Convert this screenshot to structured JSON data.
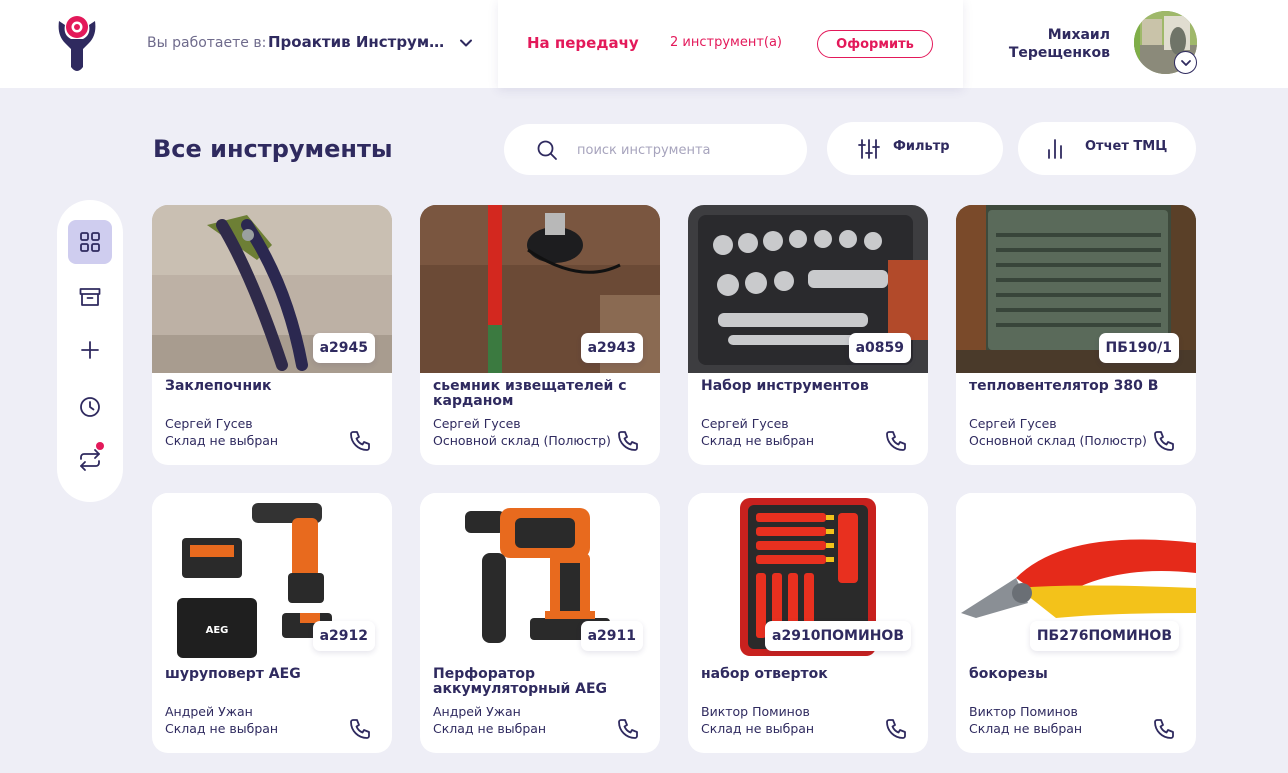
{
  "header": {
    "workspace_label": "Вы работаете в:",
    "workspace_name": "Проактив Инструме...",
    "transfer": {
      "title": "На передачу",
      "count": "2 инструмент(а)",
      "checkout_label": "Оформить"
    },
    "user": {
      "first_name": "Михаил",
      "last_name": "Терещенков"
    }
  },
  "page": {
    "title": "Все инструменты",
    "search_placeholder": "поиск инструмента",
    "filter_label": "Фильтр",
    "report_label": "Отчет ТМЦ"
  },
  "sidebar": {
    "items": [
      {
        "icon": "grid-icon",
        "active": true
      },
      {
        "icon": "archive-icon",
        "active": false
      },
      {
        "icon": "plus-icon",
        "active": false
      },
      {
        "icon": "clock-icon",
        "active": false
      },
      {
        "icon": "transfer-icon",
        "active": false,
        "notification": true
      }
    ]
  },
  "colors": {
    "accent": "#e3195a",
    "primary_text": "#2f2a5f",
    "background": "#eeeef6",
    "active_nav": "#cfcdef"
  },
  "tools": [
    {
      "code": "а2945",
      "name": "Заклепочник",
      "owner": "Сергей Гусев",
      "warehouse": "Склад не выбран"
    },
    {
      "code": "а2943",
      "name": "сьемник извещателей с карданом",
      "owner": "Сергей Гусев",
      "warehouse": "Основной склад (Полюстр)"
    },
    {
      "code": "а0859",
      "name": "Набор инструментов",
      "owner": "Сергей Гусев",
      "warehouse": "Склад не выбран"
    },
    {
      "code": "ПБ190/1",
      "name": "тепловентелятор 380 В",
      "owner": "Сергей Гусев",
      "warehouse": "Основной склад (Полюстр)"
    },
    {
      "code": "а2912",
      "name": "шуруповерт AEG",
      "owner": "Андрей Ужан",
      "warehouse": "Склад не выбран"
    },
    {
      "code": "а2911",
      "name": "Перфоратор аккумуляторный AEG",
      "owner": "Андрей Ужан",
      "warehouse": "Склад не выбран"
    },
    {
      "code": "а2910ПОМИНОВ",
      "name": "набор отверток",
      "owner": "Виктор Поминов",
      "warehouse": "Склад не выбран"
    },
    {
      "code": "ПБ276ПОМИНОВ",
      "name": "бокорезы",
      "owner": "Виктор Поминов",
      "warehouse": "Склад не выбран"
    }
  ]
}
